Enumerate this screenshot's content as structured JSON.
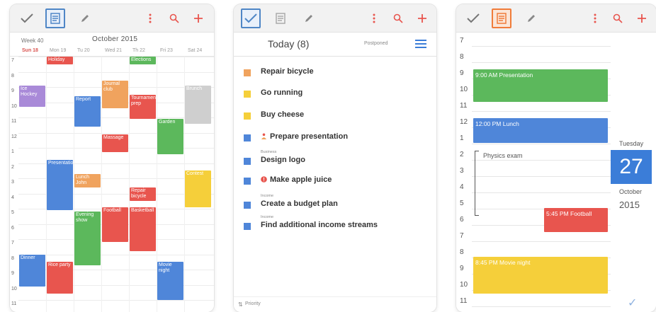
{
  "colors": {
    "red": "#e8554e",
    "green": "#5cb85c",
    "blue": "#4f86d9",
    "orange": "#f0a35e",
    "yellow": "#f5cf3a",
    "purple": "#a98ad8",
    "gray": "#cfcfcf",
    "brandRed": "#e8554e",
    "brandBlue": "#3b7dd8"
  },
  "icons": {
    "check": "checkmark-icon",
    "agenda": "agenda-icon",
    "edit": "pencil-icon",
    "more": "more-vert-icon",
    "search": "search-icon",
    "add": "plus-icon"
  },
  "week": {
    "week_label": "Week 40",
    "month_label": "October 2015",
    "days": [
      "Sun 18",
      "Mon 19",
      "Tu 20",
      "Wed 21",
      "Th 22",
      "Fri 23",
      "Sat 24"
    ],
    "today_index": 0,
    "hours": [
      "7",
      "8",
      "9",
      "10",
      "11",
      "12",
      "1",
      "2",
      "3",
      "4",
      "5",
      "6",
      "7",
      "8",
      "9",
      "10",
      "11"
    ],
    "events": [
      {
        "title": "Holiday",
        "day": 1,
        "start": 0,
        "end": 0.5,
        "color": "red"
      },
      {
        "title": "Elections",
        "day": 4,
        "start": 0,
        "end": 0.5,
        "color": "green"
      },
      {
        "title": "Ice Hockey",
        "day": 0,
        "start": 1.9,
        "end": 3.3,
        "color": "purple"
      },
      {
        "title": "Journal club",
        "day": 3,
        "start": 1.6,
        "end": 3.4,
        "color": "orange"
      },
      {
        "title": "Report",
        "day": 2,
        "start": 2.6,
        "end": 4.6,
        "color": "blue"
      },
      {
        "title": "Tournament prep",
        "day": 4,
        "start": 2.5,
        "end": 4.1,
        "color": "red"
      },
      {
        "title": "Brunch",
        "day": 6,
        "start": 1.9,
        "end": 4.4,
        "color": "gray"
      },
      {
        "title": "Garden",
        "day": 5,
        "start": 4.1,
        "end": 6.4,
        "color": "green"
      },
      {
        "title": "Massage",
        "day": 3,
        "start": 5.1,
        "end": 6.3,
        "color": "red"
      },
      {
        "title": "Presentation",
        "day": 1,
        "start": 6.8,
        "end": 10.1,
        "color": "blue"
      },
      {
        "title": "Lunch John",
        "day": 2,
        "start": 7.7,
        "end": 8.6,
        "color": "orange"
      },
      {
        "title": "Contest",
        "day": 6,
        "start": 7.5,
        "end": 9.9,
        "color": "yellow"
      },
      {
        "title": "Repair bicycle",
        "day": 4,
        "start": 8.6,
        "end": 9.5,
        "color": "red"
      },
      {
        "title": "Evening show",
        "day": 2,
        "start": 10.2,
        "end": 13.7,
        "color": "green"
      },
      {
        "title": "Football",
        "day": 3,
        "start": 9.9,
        "end": 12.2,
        "color": "red"
      },
      {
        "title": "Basketball",
        "day": 4,
        "start": 9.9,
        "end": 12.8,
        "color": "red"
      },
      {
        "title": "Dinner",
        "day": 0,
        "start": 13.0,
        "end": 15.1,
        "color": "blue"
      },
      {
        "title": "Rice party",
        "day": 1,
        "start": 13.5,
        "end": 15.6,
        "color": "red"
      },
      {
        "title": "Movie night",
        "day": 5,
        "start": 13.5,
        "end": 16.0,
        "color": "blue"
      }
    ]
  },
  "today": {
    "title": "Today (8)",
    "postponed": "Postponed",
    "footer": "Priority",
    "tasks": [
      {
        "title": "Repair bicycle",
        "category": "",
        "color": "orange",
        "icon": ""
      },
      {
        "title": "Go running",
        "category": "",
        "color": "yellow",
        "icon": ""
      },
      {
        "title": "Buy cheese",
        "category": "",
        "color": "yellow",
        "icon": ""
      },
      {
        "title": "Prepare presentation",
        "category": "",
        "color": "blue",
        "icon": "person-icon"
      },
      {
        "title": "Design logo",
        "category": "Business",
        "color": "blue",
        "icon": ""
      },
      {
        "title": "Make apple juice",
        "category": "",
        "color": "blue",
        "icon": "alert-icon"
      },
      {
        "title": "Create a budget plan",
        "category": "Income",
        "color": "blue",
        "icon": ""
      },
      {
        "title": "Find additional income streams",
        "category": "Income",
        "color": "blue",
        "icon": ""
      }
    ]
  },
  "day": {
    "hours": [
      "7",
      "8",
      "9",
      "10",
      "11",
      "12",
      "1",
      "2",
      "3",
      "4",
      "5",
      "6",
      "7",
      "8",
      "9",
      "10",
      "11"
    ],
    "dow": "Tuesday",
    "date": "27",
    "month": "October",
    "year": "2015",
    "bracket_label": "Physics exam",
    "events": [
      {
        "title": "9:00 AM Presentation",
        "start": 2.0,
        "end": 4.0,
        "color": "green"
      },
      {
        "title": "12:00 PM Lunch",
        "start": 5.0,
        "end": 6.5,
        "color": "blue"
      },
      {
        "title": "5:45 PM Football",
        "start": 10.5,
        "end": 12.0,
        "color": "red",
        "narrow": true
      },
      {
        "title": "8:45 PM Movie night",
        "start": 13.5,
        "end": 15.8,
        "color": "yellow"
      }
    ]
  }
}
